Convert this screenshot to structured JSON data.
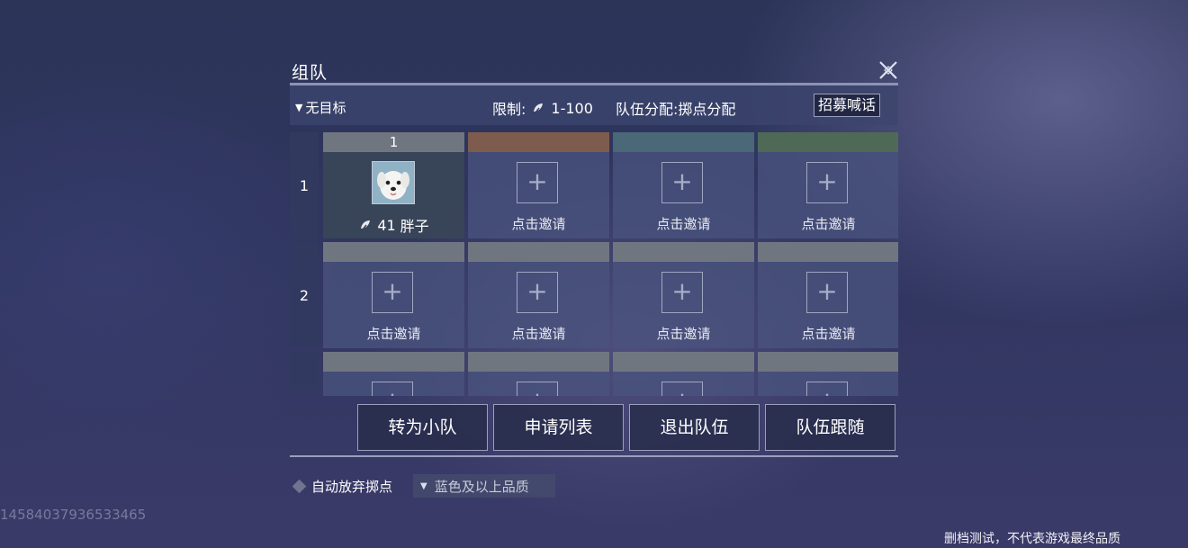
{
  "dialog": {
    "title": "组队"
  },
  "info_bar": {
    "target": "无目标",
    "limit_label": "限制:",
    "level_range": "1-100",
    "allocation": "队伍分配:掷点分配",
    "recruit_button": "招募喊话"
  },
  "team": {
    "group_numbers": [
      "1",
      "2"
    ],
    "slot1_header": "1",
    "leader": {
      "level": "41",
      "name": "胖子"
    },
    "invite_label": "点击邀请",
    "slot_header_colors": [
      "#8a8a86",
      "#7d5c4e",
      "#4a6878",
      "#4e6a56"
    ]
  },
  "buttons": {
    "to_squad": "转为小队",
    "apply_list": "申请列表",
    "leave_team": "退出队伍",
    "follow_team": "队伍跟随"
  },
  "loot": {
    "auto_abandon_label": "自动放弃掷点",
    "quality_select": "蓝色及以上品质"
  },
  "uid": "1458403793653346​5",
  "disclaimer": "删档测试，不代表游戏最终品质"
}
